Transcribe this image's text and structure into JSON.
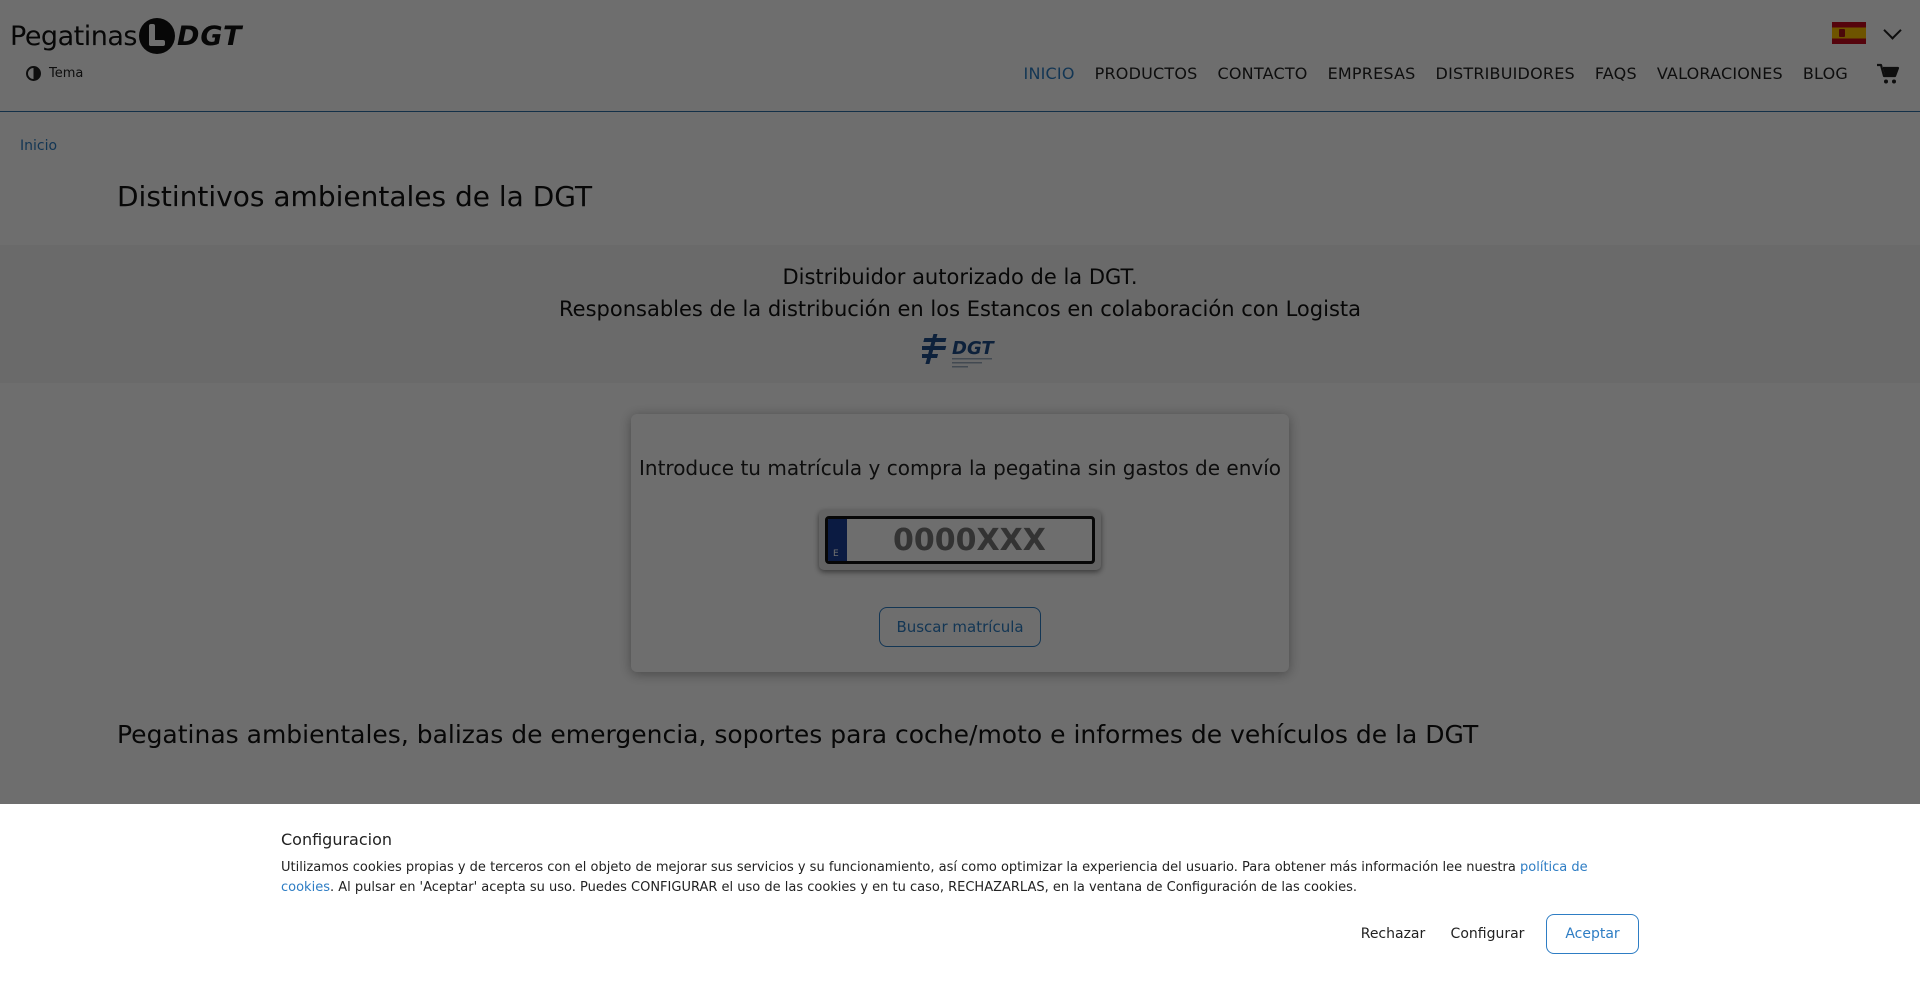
{
  "header": {
    "logo_text": "Pegatinas",
    "logo_brand": "DGT",
    "theme_label": "Tema",
    "nav": [
      {
        "label": "INICIO",
        "active": true
      },
      {
        "label": "PRODUCTOS"
      },
      {
        "label": "CONTACTO"
      },
      {
        "label": "EMPRESAS"
      },
      {
        "label": "DISTRIBUIDORES"
      },
      {
        "label": "FAQS"
      },
      {
        "label": "VALORACIONES"
      },
      {
        "label": "BLOG"
      }
    ]
  },
  "breadcrumb": "Inicio",
  "page_title": "Distintivos ambientales de la DGT",
  "banner": {
    "line1": "Distribuidor autorizado de la DGT.",
    "line2": "Responsables de la distribución en los Estancos en colaboración con Logista",
    "dgt_logo_text": "DGT"
  },
  "search": {
    "title": "Introduce tu matrícula y compra la pegatina sin gastos de envío",
    "plate_country": "E",
    "plate_placeholder": "0000XXX",
    "button_label": "Buscar matrícula"
  },
  "section_title": "Pegatinas ambientales, balizas de emergencia, soportes para coche/moto e informes de vehículos de la DGT",
  "cookie": {
    "title": "Configuracion",
    "text_before": "Utilizamos cookies propias y de terceros con el objeto de mejorar sus servicios y su funcionamiento, así como optimizar la experiencia del usuario. Para obtener más información lee nuestra ",
    "link_text": "política de cookies",
    "text_after": ". Al pulsar en 'Aceptar' acepta su uso. Puedes CONFIGURAR el uso de las cookies y en tu caso, RECHAZARLAS, en la ventana de Configuración de las cookies.",
    "reject_label": "Rechazar",
    "configure_label": "Configurar",
    "accept_label": "Aceptar"
  },
  "colors": {
    "accent": "#2e7dc4",
    "overlay": "rgba(0,0,0,0.57)",
    "plate_eu_blue": "#1a3f9a"
  }
}
